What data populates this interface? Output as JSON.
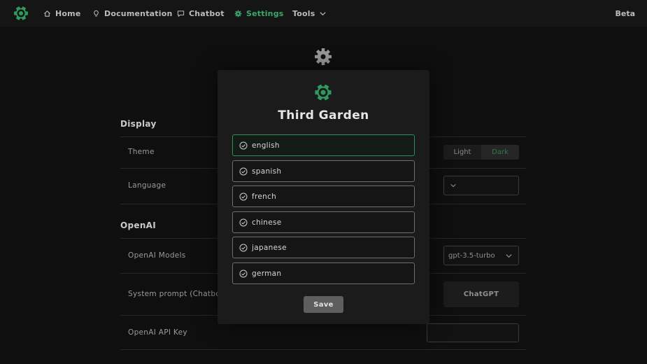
{
  "nav": {
    "items": [
      {
        "label": "Home",
        "icon": "home-icon"
      },
      {
        "label": "Documentation",
        "icon": "lightbulb-icon"
      },
      {
        "label": "Chatbot",
        "icon": "chat-bubble-icon"
      },
      {
        "label": "Settings",
        "icon": "gear-icon",
        "active": true
      },
      {
        "label": "Tools",
        "icon": "chevron-down-icon"
      }
    ],
    "beta": "Beta"
  },
  "settings": {
    "display_title": "Display",
    "theme_label": "Theme",
    "theme_options": [
      "Light",
      "Dark"
    ],
    "theme_selected": "Dark",
    "language_label": "Language",
    "openai_title": "OpenAI",
    "models_label": "OpenAI Models",
    "model_value": "gpt-3.5-turbo",
    "system_prompt_label": "System prompt (Chatbot)",
    "system_prompt_button": "ChatGPT",
    "api_key_label": "OpenAI API Key"
  },
  "modal": {
    "title": "Third Garden",
    "languages": [
      "english",
      "spanish",
      "french",
      "chinese",
      "japanese",
      "german"
    ],
    "selected_language": "english",
    "save_label": "Save"
  },
  "colors": {
    "accent": "#3aa86a",
    "background": "#0f0f0f",
    "modal_bg": "#1b1b1b"
  }
}
